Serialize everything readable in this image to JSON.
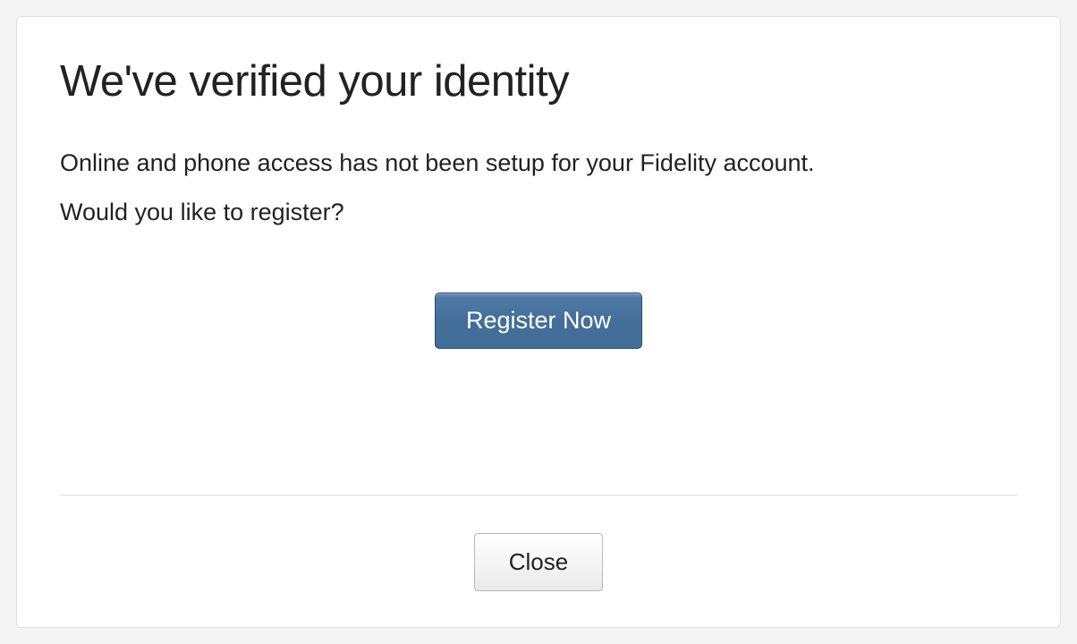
{
  "modal": {
    "title": "We've verified your identity",
    "message": "Online and phone access has not been setup for your Fidelity account.",
    "question": "Would you like to register?",
    "primary_button_label": "Register Now",
    "secondary_button_label": "Close"
  }
}
